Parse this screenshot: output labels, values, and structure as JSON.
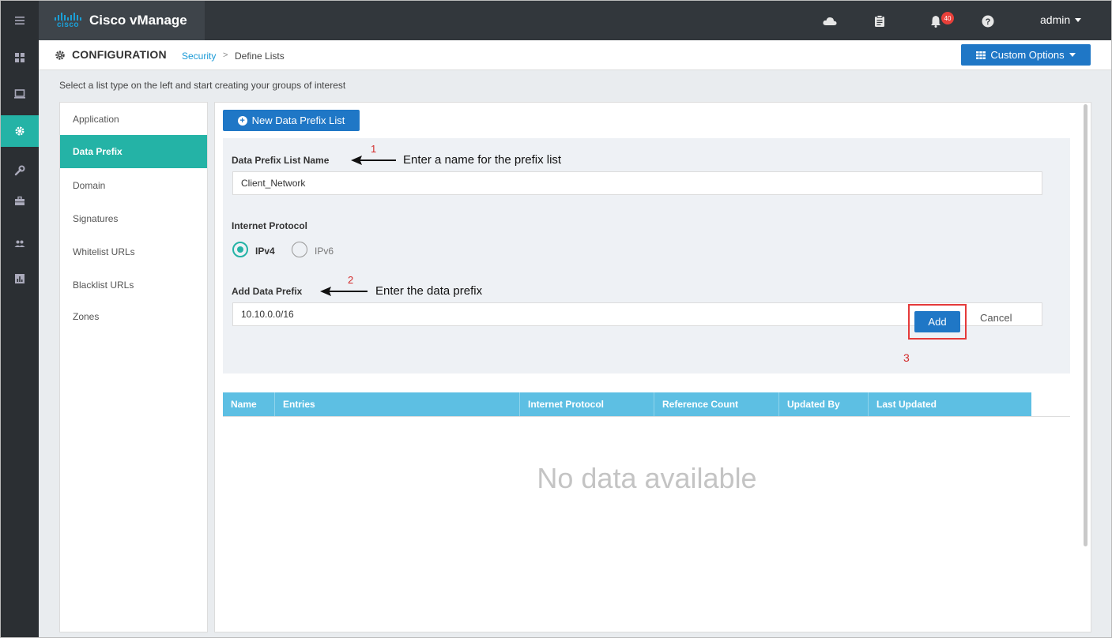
{
  "app": {
    "logo_text": "cisco",
    "title": "Cisco vManage",
    "user": "admin",
    "notification_count": "40"
  },
  "breadcrumb": {
    "section": "CONFIGURATION",
    "parent": "Security",
    "separator": ">",
    "current": "Define Lists"
  },
  "toolbar": {
    "custom_options_label": "Custom Options"
  },
  "instruction": "Select a list type on the left and start creating your groups of interest",
  "list_types": [
    {
      "label": "Application",
      "active": false
    },
    {
      "label": "Data Prefix",
      "active": true
    },
    {
      "label": "Domain",
      "active": false
    },
    {
      "label": "Signatures",
      "active": false
    },
    {
      "label": "Whitelist URLs",
      "active": false
    },
    {
      "label": "Blacklist URLs",
      "active": false
    },
    {
      "label": "Zones",
      "active": false
    }
  ],
  "form": {
    "new_button_label": "New Data Prefix List",
    "name_label": "Data Prefix List Name",
    "name_value": "Client_Network",
    "protocol_label": "Internet Protocol",
    "protocol_options": [
      "IPv4",
      "IPv6"
    ],
    "protocol_selected": "IPv4",
    "prefix_label": "Add Data Prefix",
    "prefix_value": "10.10.0.0/16",
    "add_label": "Add",
    "cancel_label": "Cancel"
  },
  "annotations": {
    "step1_num": "1",
    "step1_text": "Enter a name for the prefix list",
    "step2_num": "2",
    "step2_text": "Enter the data prefix",
    "step3_num": "3"
  },
  "table": {
    "columns": [
      "Name",
      "Entries",
      "Internet Protocol",
      "Reference Count",
      "Updated By",
      "Last Updated"
    ],
    "empty_text": "No data available"
  },
  "colors": {
    "accent_teal": "#24b3a6",
    "primary_blue": "#1f77c6",
    "table_header": "#5dbfe3",
    "annotation_red": "#e53a3a"
  },
  "icons": {
    "rail": [
      "hamburger-icon",
      "dashboard-icon",
      "monitor-icon",
      "gear-icon",
      "wrench-icon",
      "briefcase-icon",
      "users-icon",
      "analytics-icon"
    ],
    "topbar": [
      "cloud-icon",
      "clipboard-icon",
      "bell-icon",
      "help-icon"
    ]
  }
}
